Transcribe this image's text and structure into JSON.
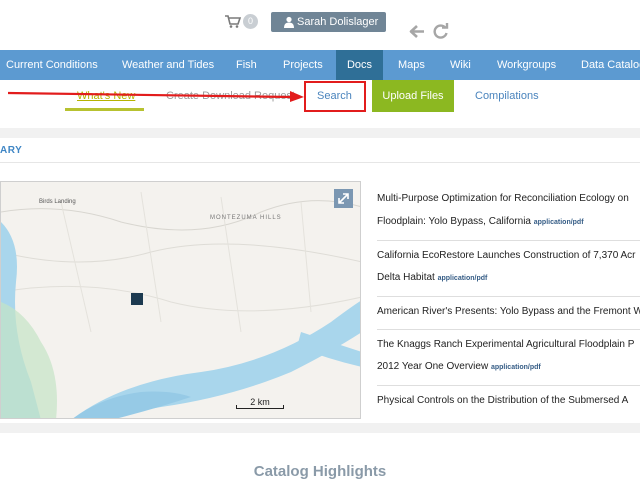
{
  "header": {
    "cart_count": "0",
    "user_name": "Sarah Dolislager"
  },
  "main_nav": {
    "items": [
      {
        "label": "Current Conditions"
      },
      {
        "label": "Weather and Tides"
      },
      {
        "label": "Fish"
      },
      {
        "label": "Projects"
      },
      {
        "label": "Docs",
        "active": true
      },
      {
        "label": "Maps"
      },
      {
        "label": "Wiki"
      },
      {
        "label": "Workgroups"
      },
      {
        "label": "Data Catalog"
      }
    ]
  },
  "sub_nav": {
    "whats_new": "What's New",
    "create_download": "Create Download Request",
    "search": "Search",
    "upload_files": "Upload Files",
    "compilations": "Compilations"
  },
  "summary": {
    "title": "ARY"
  },
  "map": {
    "labels": {
      "place1": "Birds Landing",
      "place2": "MONTEZUMA HILLS",
      "scale": "2 km"
    }
  },
  "documents": [
    {
      "line1": "Multi-Purpose Optimization for Reconciliation Ecology on",
      "line2": "Floodplain: Yolo Bypass, California",
      "mime": "application/pdf"
    },
    {
      "line1": "California EcoRestore Launches Construction of 7,370 Acr",
      "line2": "Delta Habitat",
      "mime": "application/pdf"
    },
    {
      "line1": "American River's Presents: Yolo Bypass and the Fremont W",
      "line2": "",
      "mime": ""
    },
    {
      "line1": "The Knaggs Ranch Experimental Agricultural Floodplain P",
      "line2": "2012 Year One Overview",
      "mime": "application/pdf"
    },
    {
      "line1": "Physical Controls on the Distribution of the Submersed A",
      "line2": "",
      "mime": ""
    }
  ],
  "catalog_highlights": "Catalog Highlights",
  "colors": {
    "nav_bar": "#5c9ad1",
    "nav_active": "#2f6f97",
    "upload_green": "#8cb821",
    "highlight_red": "#e21c1c"
  }
}
